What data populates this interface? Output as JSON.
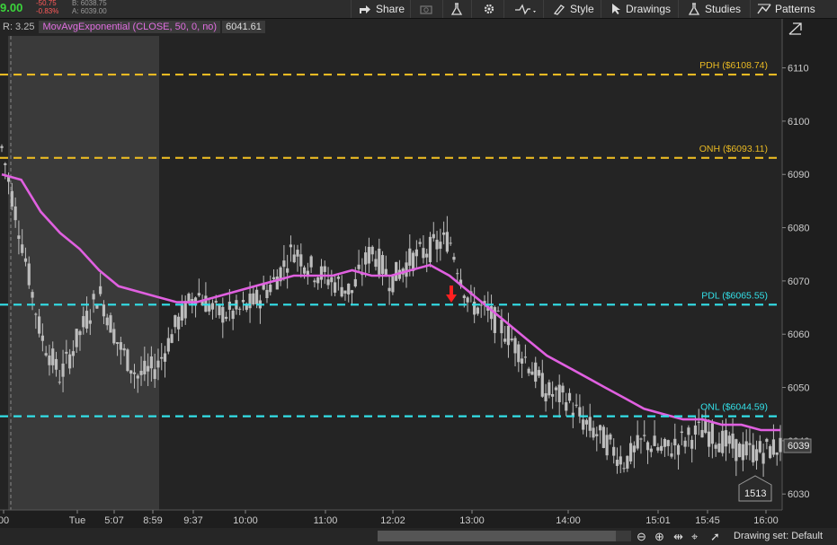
{
  "toolbar": {
    "price": "9.00",
    "net_change": "-50.75",
    "pct_change": "-0.83%",
    "bid": "B: 6038.75",
    "ask": "A: 6039.00",
    "share_label": "Share",
    "style_label": "Style",
    "drawings_label": "Drawings",
    "studies_label": "Studies",
    "patterns_label": "Patterns"
  },
  "study_bar": {
    "range": "R: 3.25",
    "ema_label": "MovAvgExponential (CLOSE, 50, 0, no)",
    "ema_value": "6041.61"
  },
  "levels": [
    {
      "label": "PDH ($6108.74)",
      "value": 6108.74,
      "color": "#e8b923"
    },
    {
      "label": "ONH ($6093.11)",
      "value": 6093.11,
      "color": "#e8b923"
    },
    {
      "label": "PDL ($6065.55)",
      "value": 6065.55,
      "color": "#33e0e8"
    },
    {
      "label": "ONL ($6044.59)",
      "value": 6044.59,
      "color": "#33e0e8"
    }
  ],
  "price_axis": {
    "ticks": [
      "6110",
      "6100",
      "6090",
      "6080",
      "6070",
      "6060",
      "6050",
      "6040",
      "6030"
    ],
    "current_price": "6039"
  },
  "time_axis": {
    "labels": [
      "00",
      "Tue",
      "5:07",
      "8:59",
      "9:37",
      "10:00",
      "11:00",
      "12:02",
      "13:00",
      "14:00",
      "15:01",
      "15:45",
      "16:00"
    ]
  },
  "volume_badge": "1513",
  "status": {
    "drawing_set": "Drawing set: Default"
  },
  "colors": {
    "ema": "#e060e0",
    "candle": "#bdbdbd",
    "signal_arrow": "#ff2020",
    "premarket_shade": "#3a3a3a"
  },
  "chart_data": {
    "type": "line",
    "title": "",
    "ylim": [
      6027,
      6116
    ],
    "ema_series": {
      "name": "MovAvgExponential (CLOSE, 50, 0, no)",
      "values": [
        6090,
        6089,
        6083,
        6079,
        6076,
        6072,
        6069,
        6068,
        6067,
        6066,
        6066,
        6067,
        6068,
        6069,
        6070,
        6071,
        6071,
        6071,
        6072,
        6071,
        6071,
        6072,
        6073,
        6071,
        6068,
        6065,
        6062,
        6059,
        6056,
        6054,
        6052,
        6050,
        6048,
        6046,
        6045,
        6044,
        6044,
        6043,
        6043,
        6042,
        6042
      ]
    },
    "price_series": {
      "name": "",
      "values": [
        6095,
        6078,
        6060,
        6052,
        6060,
        6068,
        6058,
        6052,
        6054,
        6062,
        6068,
        6064,
        6064,
        6066,
        6070,
        6076,
        6072,
        6070,
        6068,
        6076,
        6070,
        6074,
        6076,
        6078,
        6066,
        6064,
        6060,
        6055,
        6049,
        6048,
        6043,
        6040,
        6036,
        6040,
        6038,
        6040,
        6042,
        6040,
        6038,
        6038,
        6039
      ]
    }
  }
}
